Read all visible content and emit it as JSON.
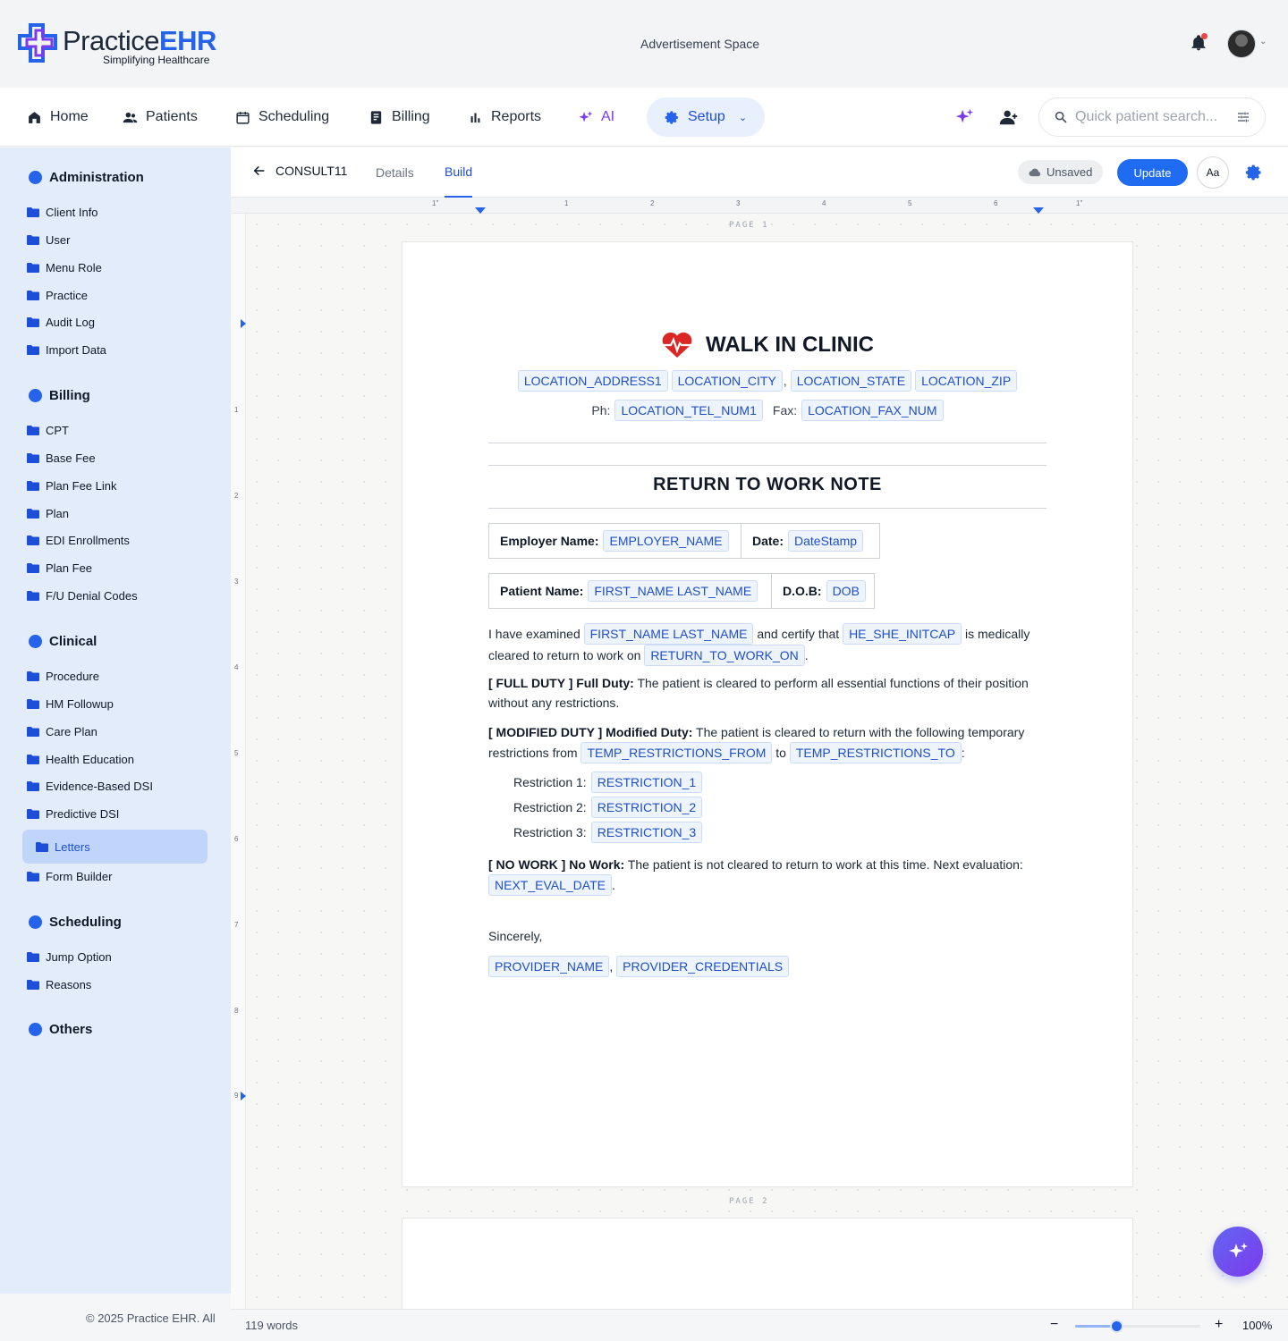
{
  "brand": {
    "name_part1": "Practice",
    "name_part2": "EHR",
    "tagline": "Simplifying Healthcare"
  },
  "header": {
    "ad_text": "Advertisement Space"
  },
  "nav": {
    "home": "Home",
    "patients": "Patients",
    "scheduling": "Scheduling",
    "billing": "Billing",
    "reports": "Reports",
    "ai": "AI",
    "setup": "Setup",
    "search_placeholder": "Quick patient search..."
  },
  "sidebar": {
    "sections": [
      {
        "title": "Administration",
        "items": [
          "Client Info",
          "User",
          "Menu Role",
          "Practice",
          "Audit Log",
          "Import Data"
        ]
      },
      {
        "title": "Billing",
        "items": [
          "CPT",
          "Base Fee",
          "Plan Fee Link",
          "Plan",
          "EDI Enrollments",
          "Plan Fee",
          "F/U Denial Codes"
        ]
      },
      {
        "title": "Clinical",
        "items": [
          "Procedure",
          "HM Followup",
          "Care Plan",
          "Health Education",
          "Evidence-Based DSI",
          "Predictive DSI",
          "Letters",
          "Form Builder"
        ]
      },
      {
        "title": "Scheduling",
        "items": [
          "Jump Option",
          "Reasons"
        ]
      },
      {
        "title": "Others",
        "items": []
      }
    ],
    "active_item": "Letters",
    "footer": "© 2025 Practice EHR. All"
  },
  "editor": {
    "doc_name": "CONSULT11",
    "tabs": {
      "details": "Details",
      "build": "Build"
    },
    "active_tab": "Build",
    "save_status": "Unsaved",
    "update_label": "Update",
    "font_button": "Aa"
  },
  "ruler": {
    "h_margin_left": "1\"",
    "h_margin_right": "1\"",
    "h_ticks": [
      "1",
      "2",
      "3",
      "4",
      "5",
      "6"
    ],
    "v_ticks": [
      "1",
      "2",
      "3",
      "4",
      "5",
      "6",
      "7",
      "8",
      "9"
    ]
  },
  "pages": {
    "page1_label": "PAGE 1",
    "page2_label": "PAGE 2"
  },
  "document": {
    "clinic_name": "WALK IN CLINIC",
    "address": {
      "addr1": "LOCATION_ADDRESS1",
      "city": "LOCATION_CITY",
      "comma": ",",
      "state": "LOCATION_STATE",
      "zip": "LOCATION_ZIP"
    },
    "phone_label": "Ph:",
    "phone": "LOCATION_TEL_NUM1",
    "fax_label": "Fax:",
    "fax": "LOCATION_FAX_NUM",
    "note_title": "RETURN TO WORK NOTE",
    "employer_label": "Employer Name:",
    "employer": "EMPLOYER_NAME",
    "date_label": "Date:",
    "date": "DateStamp",
    "patient_label": "Patient Name:",
    "patient": "FIRST_NAME LAST_NAME",
    "dob_label": "D.O.B:",
    "dob": "DOB",
    "exam": {
      "t1": "I have examined",
      "patient": "FIRST_NAME LAST_NAME",
      "t2": "and certify that",
      "pronoun": "HE_SHE_INITCAP",
      "t3": "is medically cleared to return to work on",
      "rtw": "RETURN_TO_WORK_ON",
      "t4": "."
    },
    "full_duty": {
      "tag": "[ FULL DUTY ] Full Duty:",
      "text": "The patient is cleared to perform all essential functions of their position without any restrictions."
    },
    "modified_duty": {
      "tag": "[ MODIFIED DUTY ] Modified Duty:",
      "t1": "The patient is cleared to return with the following temporary restrictions from",
      "from": "TEMP_RESTRICTIONS_FROM",
      "t2": "to",
      "to": "TEMP_RESTRICTIONS_TO",
      "t3": ":"
    },
    "restrictions": [
      {
        "label": "Restriction 1:",
        "value": "RESTRICTION_1"
      },
      {
        "label": "Restriction 2:",
        "value": "RESTRICTION_2"
      },
      {
        "label": "Restriction 3:",
        "value": "RESTRICTION_3"
      }
    ],
    "no_work": {
      "tag": "[ NO WORK ] No Work:",
      "text": "The patient is not cleared to return to work at this time. Next evaluation:",
      "next_eval": "NEXT_EVAL_DATE",
      "t_end": "."
    },
    "closing": "Sincerely,",
    "provider_name": "PROVIDER_NAME",
    "provider_sep": ",",
    "provider_credentials": "PROVIDER_CREDENTIALS"
  },
  "status_bar": {
    "words": "119 words",
    "zoom_out": "−",
    "zoom_in": "+",
    "zoom": "100%",
    "zoom_level": 0.33
  },
  "colors": {
    "accent": "#2563eb",
    "sidebar_bg": "#e3ecfb",
    "ai": "#7c3aed",
    "heart": "#dc2626"
  },
  "icons": [
    "home-icon",
    "patients-icon",
    "calendar-icon",
    "billing-icon",
    "reports-icon",
    "sparkle-icon",
    "gear-icon",
    "bell-icon",
    "add-user-icon",
    "search-icon",
    "filter-icon",
    "folder-icon",
    "back-arrow-icon",
    "cloud-icon",
    "heart-pulse-icon"
  ]
}
